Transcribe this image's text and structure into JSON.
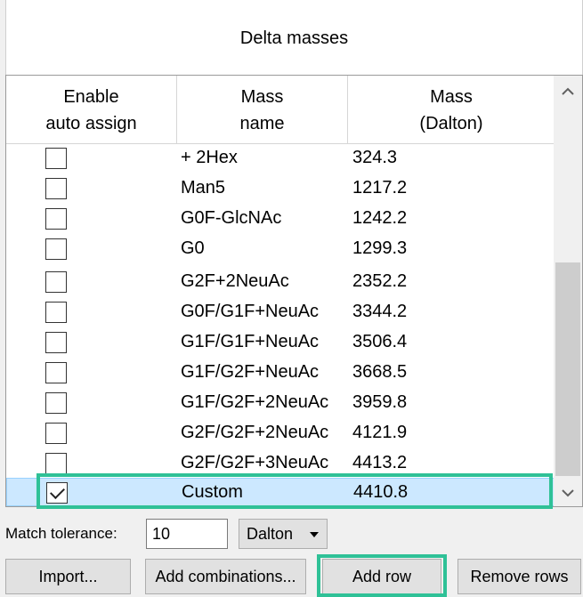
{
  "panel": {
    "title": "Delta masses"
  },
  "table": {
    "headers": [
      "Enable\nauto assign",
      "Mass\nname",
      "Mass\n(Dalton)"
    ],
    "rows": [
      {
        "name": "+ 2Hex",
        "mass": "324.3",
        "checked": false
      },
      {
        "name": "Man5",
        "mass": "1217.2",
        "checked": false
      },
      {
        "name": "G0F-GlcNAc",
        "mass": "1242.2",
        "checked": false
      },
      {
        "name": "G0",
        "mass": "1299.3",
        "checked": false
      },
      {
        "name": "G2F+2NeuAc",
        "mass": "2352.2",
        "checked": false
      },
      {
        "name": "G0F/G1F+NeuAc",
        "mass": "3344.2",
        "checked": false
      },
      {
        "name": "G1F/G1F+NeuAc",
        "mass": "3506.4",
        "checked": false
      },
      {
        "name": "G1F/G2F+NeuAc",
        "mass": "3668.5",
        "checked": false
      },
      {
        "name": "G1F/G2F+2NeuAc",
        "mass": "3959.8",
        "checked": false
      },
      {
        "name": "G2F/G2F+2NeuAc",
        "mass": "4121.9",
        "checked": false
      },
      {
        "name": "G2F/G2F+3NeuAc",
        "mass": "4413.2",
        "checked": false
      },
      {
        "name": "Custom",
        "mass": "4410.8",
        "checked": true,
        "selected": true
      }
    ]
  },
  "tolerance": {
    "label": "Match tolerance:",
    "value": "10",
    "unit": "Dalton"
  },
  "buttons": {
    "import": "Import...",
    "add_combinations": "Add combinations...",
    "add_row": "Add row",
    "remove_rows": "Remove rows"
  },
  "colors": {
    "highlight": "#2fc197",
    "selection": "#cce8ff"
  },
  "icons": {
    "scroll_up": "chevron-up-icon",
    "scroll_down": "chevron-down-icon",
    "dropdown": "caret-down-icon"
  }
}
